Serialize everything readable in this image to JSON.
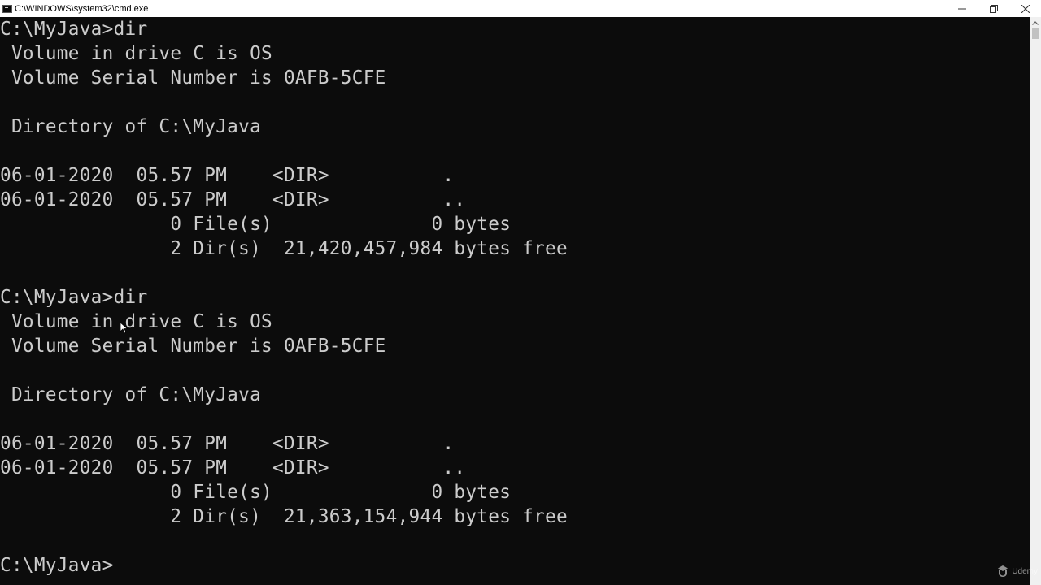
{
  "window": {
    "title": "C:\\WINDOWS\\system32\\cmd.exe",
    "minimize_label": "—",
    "restore_label": "❐",
    "close_label": "✕"
  },
  "console": {
    "lines": [
      "C:\\MyJava>dir",
      " Volume in drive C is OS",
      " Volume Serial Number is 0AFB-5CFE",
      "",
      " Directory of C:\\MyJava",
      "",
      "06-01-2020  05.57 PM    <DIR>          .",
      "06-01-2020  05.57 PM    <DIR>          ..",
      "               0 File(s)              0 bytes",
      "               2 Dir(s)  21,420,457,984 bytes free",
      "",
      "C:\\MyJava>dir",
      " Volume in drive C is OS",
      " Volume Serial Number is 0AFB-5CFE",
      "",
      " Directory of C:\\MyJava",
      "",
      "06-01-2020  05.57 PM    <DIR>          .",
      "06-01-2020  05.57 PM    <DIR>          ..",
      "               0 File(s)              0 bytes",
      "               2 Dir(s)  21,363,154,944 bytes free",
      "",
      "C:\\MyJava>"
    ]
  },
  "watermark": {
    "text": "Udemy"
  },
  "colors": {
    "console_bg": "#0c0c0c",
    "console_fg": "#cccccc",
    "titlebar_bg": "#ffffff"
  }
}
